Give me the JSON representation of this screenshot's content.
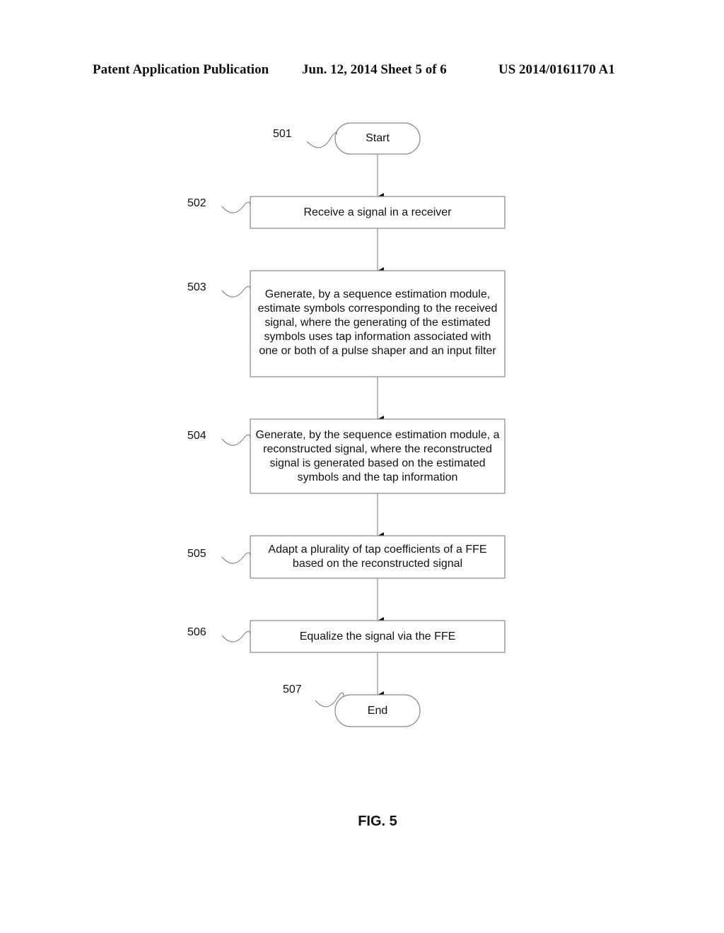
{
  "header": {
    "publication": "Patent Application Publication",
    "date_sheet": "Jun. 12, 2014  Sheet 5 of 6",
    "number": "US 2014/0161170 A1"
  },
  "flowchart": {
    "nodes": [
      {
        "ref": "501",
        "type": "terminal",
        "text": "Start"
      },
      {
        "ref": "502",
        "type": "process",
        "text": "Receive a signal in a receiver"
      },
      {
        "ref": "503",
        "type": "process",
        "text": "Generate, by a sequence estimation module, estimate symbols corresponding to the received signal, where the generating of the estimated symbols uses tap information associated with one or both of a pulse shaper and an input filter"
      },
      {
        "ref": "504",
        "type": "process",
        "text": "Generate, by the sequence estimation module, a reconstructed signal, where the reconstructed signal is generated based on the estimated symbols and the tap information"
      },
      {
        "ref": "505",
        "type": "process",
        "text": "Adapt a plurality of tap coefficients of a FFE based on the reconstructed signal"
      },
      {
        "ref": "506",
        "type": "process",
        "text": "Equalize the signal via the FFE"
      },
      {
        "ref": "507",
        "type": "terminal",
        "text": "End"
      }
    ],
    "edges": [
      [
        "501",
        "502"
      ],
      [
        "502",
        "503"
      ],
      [
        "503",
        "504"
      ],
      [
        "504",
        "505"
      ],
      [
        "505",
        "506"
      ],
      [
        "506",
        "507"
      ]
    ]
  },
  "figure_label": "FIG. 5"
}
